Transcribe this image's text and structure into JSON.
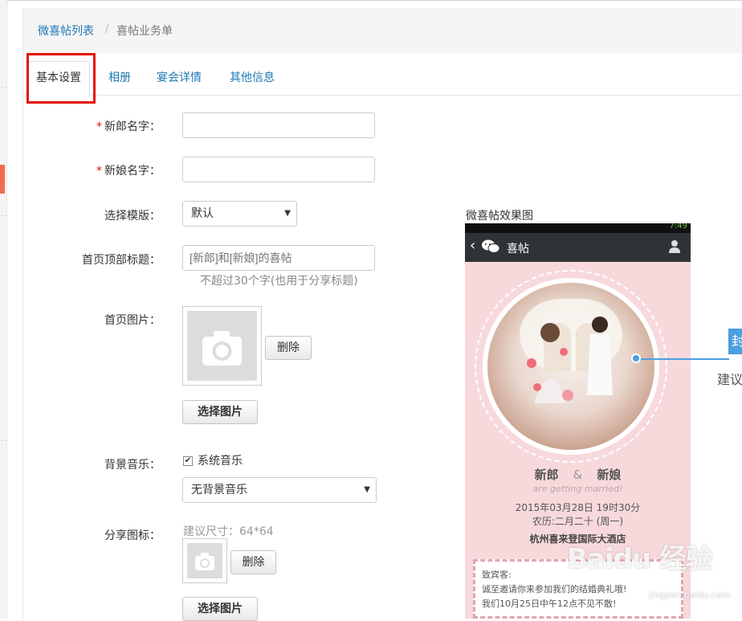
{
  "breadcrumb": {
    "parent": "微喜帖列表",
    "separator": "/",
    "current": "喜帖业务单"
  },
  "tabs": [
    {
      "label": "基本设置",
      "active": true
    },
    {
      "label": "相册",
      "active": false
    },
    {
      "label": "宴会详情",
      "active": false
    },
    {
      "label": "其他信息",
      "active": false
    }
  ],
  "form": {
    "groom": {
      "label": "新郎名字：",
      "required": true,
      "value": ""
    },
    "bride": {
      "label": "新娘名字：",
      "required": true,
      "value": ""
    },
    "template": {
      "label": "选择模版：",
      "selected": "默认"
    },
    "home_title": {
      "label": "首页顶部标题：",
      "placeholder": "[新郎]和[新娘]的喜帖",
      "help": "不超过30个字(也用于分享标题)"
    },
    "home_image": {
      "label": "首页图片：",
      "delete_label": "删除",
      "choose_label": "选择图片"
    },
    "bg_music": {
      "label": "背景音乐：",
      "checkbox_label": "系统音乐",
      "checked": true,
      "selected": "无背景音乐"
    },
    "share_icon": {
      "label": "分享图标：",
      "hint": "建议尺寸：64*64",
      "delete_label": "删除",
      "choose_label": "选择图片"
    }
  },
  "preview": {
    "title": "微喜帖效果图",
    "header_title": "喜帖",
    "status_text": "7:49",
    "groom": "新郎",
    "amp": "&",
    "bride": "新娘",
    "tagline": "are getting married!",
    "date_line": "2015年03月28日 19时30分",
    "lunar_line": "农历:二月二十 (周一)",
    "venue": "杭州喜来登国际大酒店",
    "invite_1": "致宾客:",
    "invite_2": "诚至邀请你来参加我们的结婚典礼哦!",
    "invite_3": "我们10月25日中午12点不见不散!"
  },
  "callout": {
    "box_text": "封",
    "text": "建议"
  },
  "watermark": {
    "text": "Baidu 经验",
    "sub": "jingyan.baidu.com"
  },
  "colors": {
    "link": "#1f78b4",
    "required": "#e3120b",
    "highlight": "#e3120b",
    "callout": "#4a9fe0",
    "phone_bg": "#f7d9dc"
  }
}
